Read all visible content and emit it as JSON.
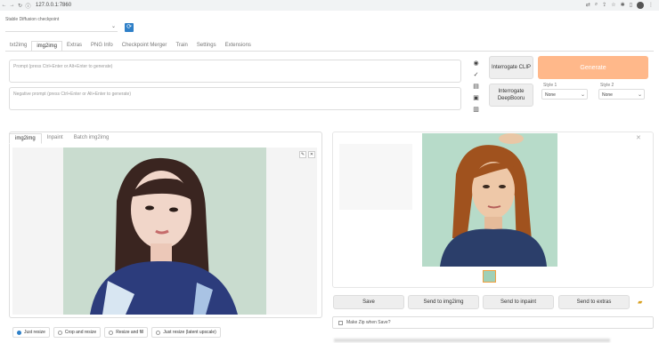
{
  "browser": {
    "url": "127.0.0.1:7860"
  },
  "checkpoint": {
    "label": "Stable Diffusion checkpoint",
    "value": ""
  },
  "tabs": [
    "txt2img",
    "img2img",
    "Extras",
    "PNG Info",
    "Checkpoint Merger",
    "Train",
    "Settings",
    "Extensions"
  ],
  "prompt": {
    "placeholder": "Prompt (press Ctrl+Enter or Alt+Enter to generate)"
  },
  "negative_prompt": {
    "placeholder": "Negative prompt (press Ctrl+Enter or Alt+Enter to generate)"
  },
  "buttons": {
    "interrogate_clip": "Interrogate CLIP",
    "interrogate_deepbooru": "Interrogate DeepBooru",
    "generate": "Generate"
  },
  "styles": {
    "style1": {
      "label": "Style 1",
      "value": "None"
    },
    "style2": {
      "label": "Style 2",
      "value": "None"
    }
  },
  "sub_tabs": [
    "img2img",
    "Inpaint",
    "Batch img2img"
  ],
  "resize_modes": [
    "Just resize",
    "Crop and resize",
    "Resize and fill",
    "Just resize (latent upscale)"
  ],
  "selected_resize": "Just resize",
  "actions": [
    "Save",
    "Send to img2img",
    "Send to inpaint",
    "Send to extras"
  ],
  "zip": {
    "label": "Make Zip when Save?"
  },
  "colors": {
    "generate": "#ffb88a",
    "accent": "#2f80c8"
  },
  "icons": [
    "back-icon",
    "forward-icon",
    "reload-icon",
    "info-icon",
    "refresh-icon",
    "folder-icon",
    "close-icon"
  ]
}
